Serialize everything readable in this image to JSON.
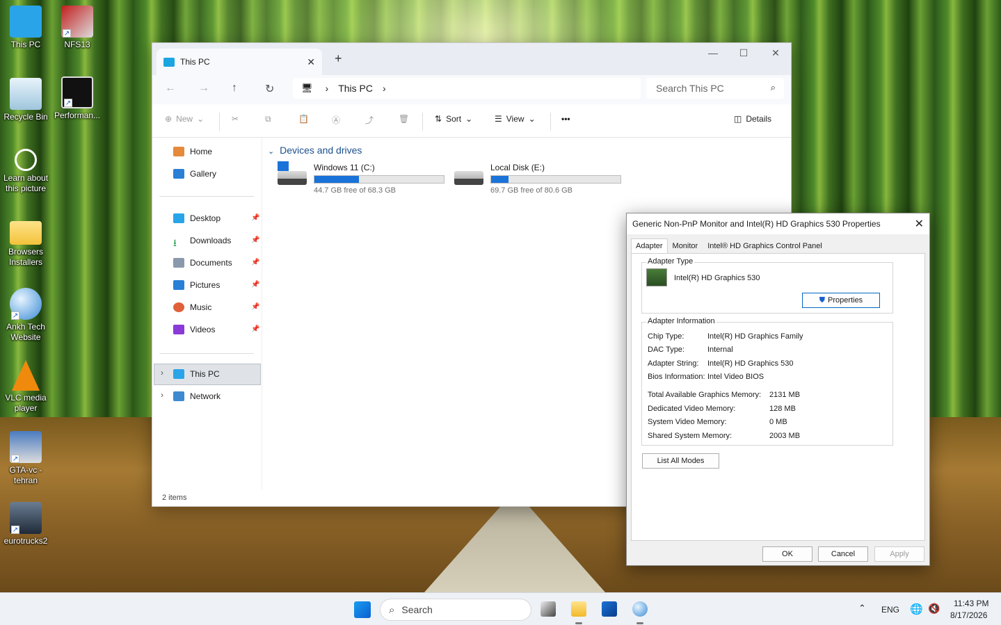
{
  "desktop": {
    "icons": [
      {
        "label": "This PC"
      },
      {
        "label": "NFS13"
      },
      {
        "label": "Recycle Bin"
      },
      {
        "label": "Performan..."
      },
      {
        "label": "Learn about this picture"
      },
      {
        "label": "Browsers Installers"
      },
      {
        "label": "Ankh Tech Website"
      },
      {
        "label": "VLC media player"
      },
      {
        "label": "GTA-vc - tehran"
      },
      {
        "label": "eurotrucks2"
      }
    ]
  },
  "explorer": {
    "tab_title": "This PC",
    "breadcrumb": "This PC",
    "search_placeholder": "Search This PC",
    "toolbar": {
      "new_label": "New",
      "sort_label": "Sort",
      "view_label": "View",
      "more_label": "•••",
      "details_label": "Details"
    },
    "nav": {
      "home": "Home",
      "gallery": "Gallery",
      "desktop": "Desktop",
      "downloads": "Downloads",
      "documents": "Documents",
      "pictures": "Pictures",
      "music": "Music",
      "videos": "Videos",
      "this_pc": "This PC",
      "network": "Network"
    },
    "section_title": "Devices and drives",
    "drives": [
      {
        "name": "Windows 11 (C:)",
        "free_text": "44.7 GB free of 68.3 GB",
        "used_fraction": 0.346
      },
      {
        "name": "Local Disk (E:)",
        "free_text": "69.7 GB free of 80.6 GB",
        "used_fraction": 0.135
      }
    ],
    "status": "2 items"
  },
  "dialog": {
    "title": "Generic Non-PnP Monitor and Intel(R) HD Graphics 530 Properties",
    "tabs": [
      "Adapter",
      "Monitor",
      "Intel® HD Graphics Control Panel"
    ],
    "adapter_type_label": "Adapter Type",
    "adapter_name": "Intel(R) HD Graphics 530",
    "properties_button": "Properties",
    "adapter_info_label": "Adapter Information",
    "info": [
      {
        "k": "Chip Type:",
        "v": "Intel(R) HD Graphics Family"
      },
      {
        "k": "DAC Type:",
        "v": "Internal"
      },
      {
        "k": "Adapter String:",
        "v": "Intel(R) HD Graphics 530"
      },
      {
        "k": "Bios Information:",
        "v": "Intel Video BIOS"
      }
    ],
    "memory": [
      {
        "k": "Total Available Graphics Memory:",
        "v": "2131 MB"
      },
      {
        "k": "Dedicated Video Memory:",
        "v": "128 MB"
      },
      {
        "k": "System Video Memory:",
        "v": "0 MB"
      },
      {
        "k": "Shared System Memory:",
        "v": "2003 MB"
      }
    ],
    "list_modes_button": "List All Modes",
    "ok": "OK",
    "cancel": "Cancel",
    "apply": "Apply"
  },
  "taskbar": {
    "search_placeholder": "Search",
    "lang": "ENG",
    "time": "11:43 PM",
    "date": "8/17/2026"
  }
}
